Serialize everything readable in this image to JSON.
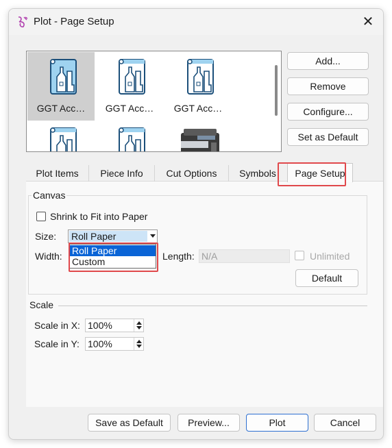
{
  "window": {
    "title": "Plot - Page Setup",
    "close_glyph": "✕"
  },
  "plotters": [
    {
      "label": "GGT Acc…",
      "icon": "cutter-plotter-icon",
      "selected": true
    },
    {
      "label": "GGT Acc…",
      "icon": "cutter-plotter-icon",
      "selected": false
    },
    {
      "label": "GGT Acc…",
      "icon": "cutter-plotter-icon",
      "selected": false
    },
    {
      "label": "",
      "icon": "cutter-plotter-icon",
      "selected": false
    },
    {
      "label": "",
      "icon": "cutter-plotter-icon",
      "selected": false
    },
    {
      "label": "",
      "icon": "printer-icon",
      "selected": false
    }
  ],
  "side_buttons": {
    "add": "Add...",
    "remove": "Remove",
    "configure": "Configure...",
    "set_default": "Set as Default"
  },
  "tabs": [
    "Plot Items",
    "Piece Info",
    "Cut Options",
    "Symbols",
    "Page Setup"
  ],
  "active_tab": "Page Setup",
  "canvas": {
    "group_title": "Canvas",
    "shrink_label": "Shrink to Fit into Paper",
    "shrink_checked": false,
    "size_label": "Size:",
    "size_value": "Roll Paper",
    "size_options": [
      "Roll Paper",
      "Custom"
    ],
    "width_label": "Width:",
    "length_label": "Length:",
    "length_value": "N/A",
    "unlimited_label": "Unlimited",
    "default_button": "Default"
  },
  "scale": {
    "group_title": "Scale",
    "x_label": "Scale in X:",
    "x_value": "100%",
    "y_label": "Scale in Y:",
    "y_value": "100%"
  },
  "footer": {
    "save_default": "Save as Default",
    "preview": "Preview...",
    "plot": "Plot",
    "cancel": "Cancel"
  },
  "colors": {
    "accent": "#0a64d6",
    "highlight_outline": "#e0484b",
    "selection": "#cde4f7"
  }
}
